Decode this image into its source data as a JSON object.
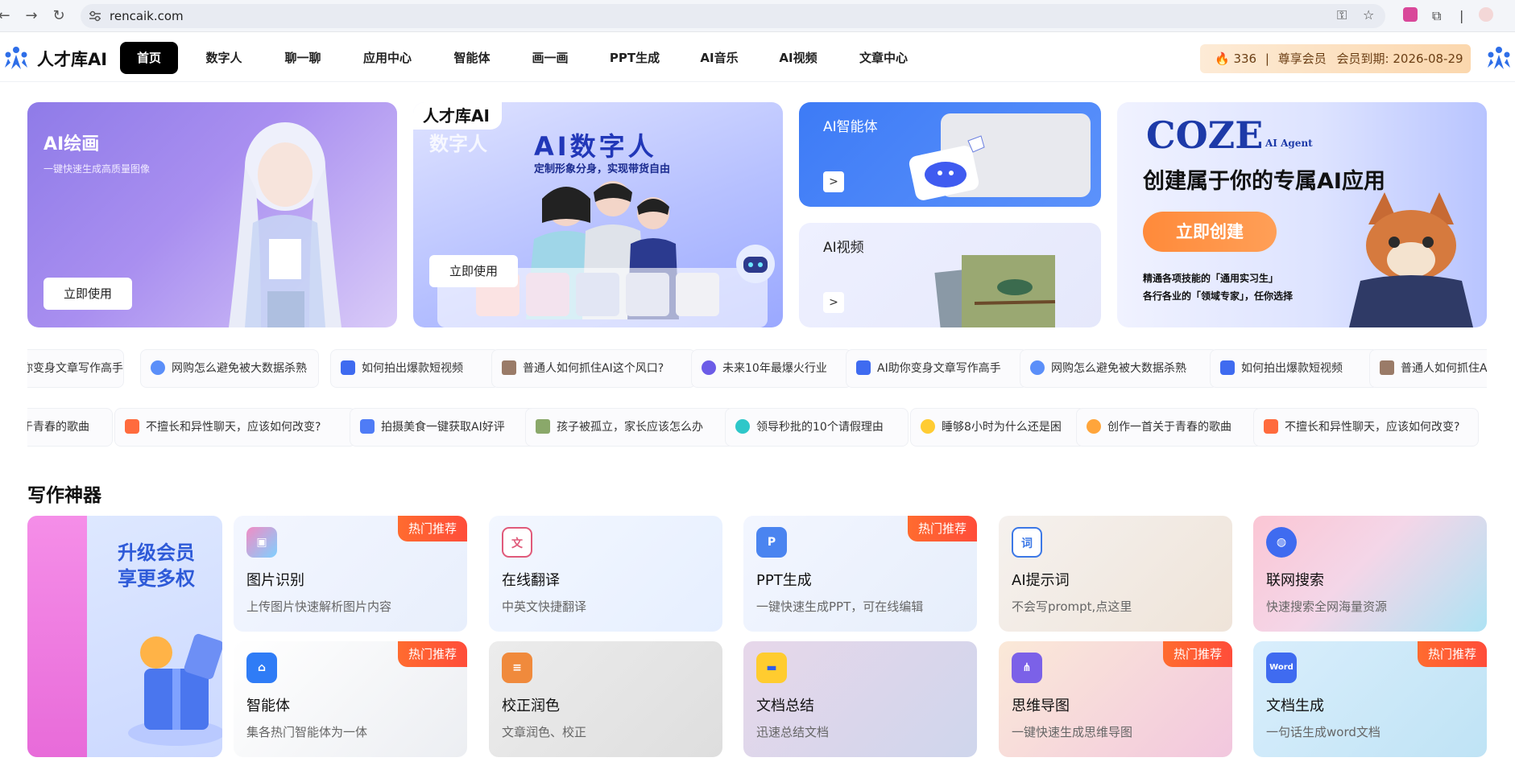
{
  "browser": {
    "url": "rencaik.com",
    "back_icon": "arrow-left-icon",
    "forward_icon": "arrow-right-icon",
    "reload_icon": "reload-icon"
  },
  "header": {
    "logo_text": "人才库AI",
    "nav": [
      "首页",
      "数字人",
      "聊一聊",
      "应用中心",
      "智能体",
      "画一画",
      "PPT生成",
      "AI音乐",
      "AI视频",
      "文章中心"
    ],
    "points": "336",
    "member_level": "尊享会员",
    "expiry": "会员到期: 2026-08-29"
  },
  "banners": {
    "painting": {
      "title": "AI绘画",
      "subtitle": "一键快速生成高质量图像",
      "button": "立即使用"
    },
    "digital_human": {
      "tag": "人才库AI",
      "ghost": "数字人",
      "title": "AI数字人",
      "subtitle": "定制形象分身，实现带货自由",
      "button": "立即使用"
    },
    "agent": {
      "title": "AI智能体",
      "arrow": ">"
    },
    "video": {
      "title": "AI视频",
      "arrow": ">"
    },
    "coze": {
      "brand": "COZE",
      "brand_sub": "AI Agent",
      "title": "创建属于你的专属AI应用",
      "button": "立即创建",
      "line1": "精通各项技能的「通用实习生」",
      "line2": "各行各业的「领域专家」，任你选择"
    }
  },
  "ticker1": [
    "你变身文章写作高手",
    "网购怎么避免被大数据杀熟",
    "如何拍出爆款短视频",
    "普通人如何抓住AI这个风口?",
    "未来10年最爆火行业",
    "AI助你变身文章写作高手",
    "网购怎么避免被大数据杀熟",
    "如何拍出爆款短视频",
    "普通人如何抓住AI这"
  ],
  "ticker2": [
    "于青春的歌曲",
    "不擅长和异性聊天，应该如何改变?",
    "拍摄美食一键获取AI好评",
    "孩子被孤立，家长应该怎么办",
    "领导秒批的10个请假理由",
    "睡够8小时为什么还是困",
    "创作一首关于青春的歌曲",
    "不擅长和异性聊天，应该如何改变?"
  ],
  "writing": {
    "section_title": "写作神器",
    "promo_line1": "升级会员",
    "promo_line2": "享更多权",
    "hot_label": "热门推荐",
    "tools": [
      {
        "title": "图片识别",
        "desc": "上传图片快速解析图片内容",
        "icon": "image-recognition-icon",
        "hot": true
      },
      {
        "title": "在线翻译",
        "desc": "中英文快捷翻译",
        "icon": "translate-icon",
        "hot": false
      },
      {
        "title": "PPT生成",
        "desc": "一键快速生成PPT，可在线编辑",
        "icon": "ppt-icon",
        "hot": true
      },
      {
        "title": "AI提示词",
        "desc": "不会写prompt,点这里",
        "icon": "prompt-icon",
        "hot": false
      },
      {
        "title": "联网搜索",
        "desc": "快速搜索全网海量资源",
        "icon": "globe-icon",
        "hot": false
      },
      {
        "title": "智能体",
        "desc": "集各热门智能体为一体",
        "icon": "robot-icon",
        "hot": true
      },
      {
        "title": "校正润色",
        "desc": "文章润色、校正",
        "icon": "proofread-icon",
        "hot": false
      },
      {
        "title": "文档总结",
        "desc": "迅速总结文档",
        "icon": "document-summary-icon",
        "hot": false
      },
      {
        "title": "思维导图",
        "desc": "一键快速生成思维导图",
        "icon": "mindmap-icon",
        "hot": true
      },
      {
        "title": "文档生成",
        "desc": "一句话生成word文档",
        "icon": "word-icon",
        "hot": true
      }
    ]
  },
  "colors": {
    "accent_black": "#000000",
    "hot_badge": "#ff5a36",
    "brand_blue": "#2137b8",
    "create_orange": "#ff8a3a"
  }
}
